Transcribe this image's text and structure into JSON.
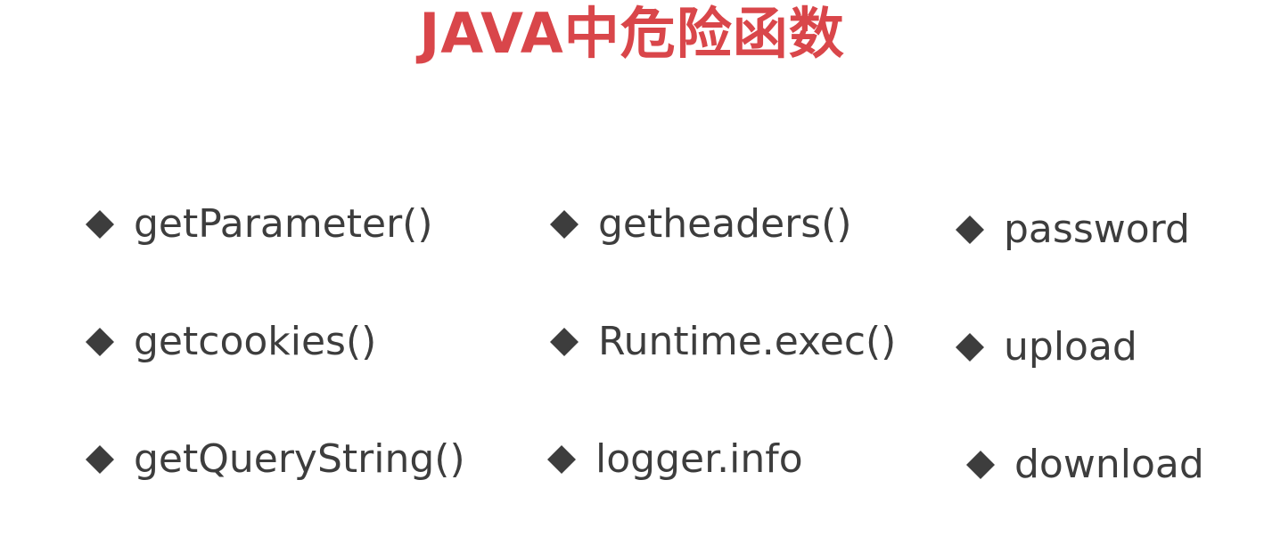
{
  "slide": {
    "title": "JAVA中危险函数",
    "title_color": "#d9464a",
    "text_color": "#3d3d3d",
    "bullet_icon": "diamond-bullet-icon",
    "columns": [
      {
        "items": [
          {
            "label": "getParameter()"
          },
          {
            "label": "getcookies()"
          },
          {
            "label": "getQueryString()"
          }
        ]
      },
      {
        "items": [
          {
            "label": "getheaders()"
          },
          {
            "label": "Runtime.exec()"
          },
          {
            "label": "logger.info"
          }
        ]
      },
      {
        "items": [
          {
            "label": "password"
          },
          {
            "label": "upload"
          },
          {
            "label": "download"
          }
        ]
      }
    ]
  }
}
